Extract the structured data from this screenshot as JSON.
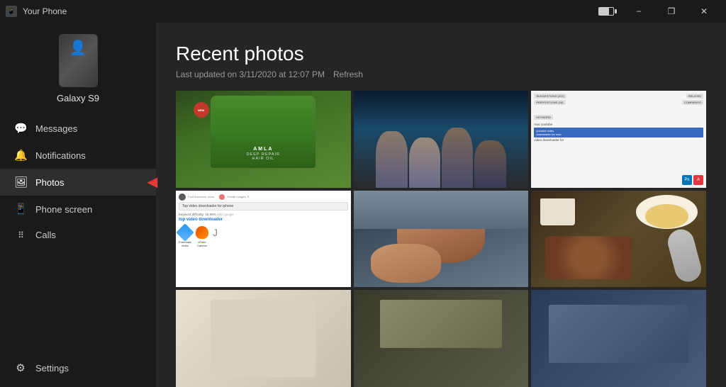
{
  "titlebar": {
    "app_name": "Your Phone",
    "battery_icon": "battery",
    "minimize_label": "−",
    "restore_label": "❐",
    "close_label": "✕"
  },
  "sidebar": {
    "phone_name": "Galaxy S9",
    "nav_items": [
      {
        "id": "messages",
        "label": "Messages",
        "icon": "💬"
      },
      {
        "id": "notifications",
        "label": "Notifications",
        "icon": "🔔"
      },
      {
        "id": "photos",
        "label": "Photos",
        "icon": "🖼",
        "active": true
      },
      {
        "id": "phone-screen",
        "label": "Phone screen",
        "icon": "📱"
      },
      {
        "id": "calls",
        "label": "Calls",
        "icon": "⠿"
      }
    ],
    "settings_label": "Settings",
    "settings_icon": "⚙"
  },
  "main": {
    "page_title": "Recent photos",
    "last_updated_label": "Last updated on 3/11/2020 at 12:07 PM",
    "refresh_label": "Refresh"
  },
  "photos": {
    "cells": [
      {
        "id": "photo-1",
        "alt": "Hair oil bottle"
      },
      {
        "id": "photo-2",
        "alt": "Group of women"
      },
      {
        "id": "photo-3",
        "alt": "Screen with search suggestions"
      },
      {
        "id": "photo-4",
        "alt": "Video downloader search"
      },
      {
        "id": "photo-5",
        "alt": "Selfie with child"
      },
      {
        "id": "photo-6",
        "alt": "Food on table"
      },
      {
        "id": "photo-7",
        "alt": "Partial photo 1"
      },
      {
        "id": "photo-8",
        "alt": "Partial photo 2"
      },
      {
        "id": "photo-9",
        "alt": "Partial photo 3"
      }
    ]
  }
}
